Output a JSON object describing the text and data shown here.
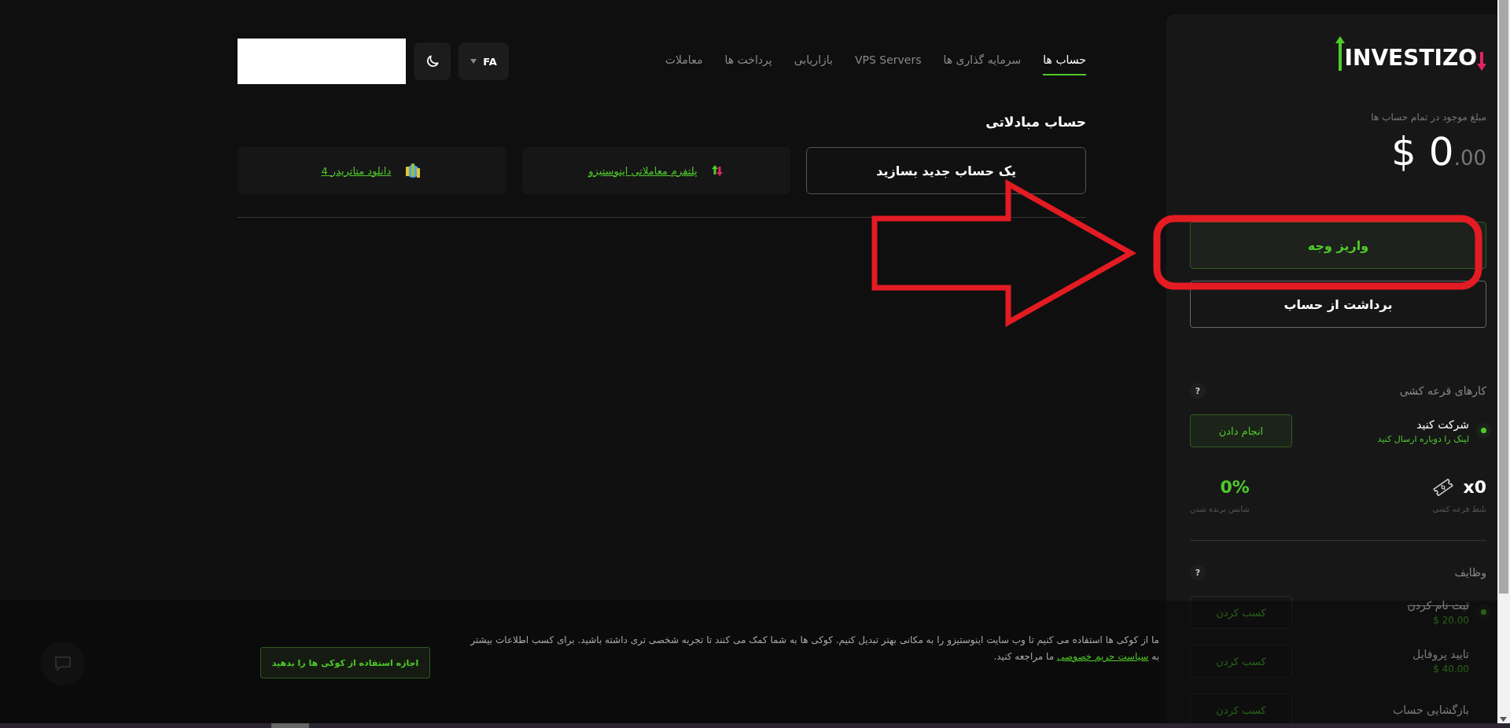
{
  "nav": {
    "tabs": [
      {
        "label": "حساب ها",
        "selected": true
      },
      {
        "label": "سرمایه گذاری ها",
        "selected": false
      },
      {
        "label": "VPS Servers",
        "selected": false
      },
      {
        "label": "بازاریابی",
        "selected": false
      },
      {
        "label": "پرداخت ها",
        "selected": false
      },
      {
        "label": "معاملات",
        "selected": false
      }
    ],
    "language": "FA"
  },
  "section": {
    "title": "حساب مبادلاتی",
    "cards": [
      {
        "kind": "create",
        "label": "یک حساب جدید بسازید"
      },
      {
        "kind": "platform",
        "label": "پلتفرم معاملاتی اینوستیزو"
      },
      {
        "kind": "metatrader",
        "label": "دانلود متاتریدر 4"
      }
    ]
  },
  "sidebar": {
    "logo": "INVESTIZO",
    "balance": {
      "label": "مبلغ موجود در تمام حساب ها",
      "amount": "$ 0",
      "decimals": ".00"
    },
    "deposit_button": "واریز وجه",
    "withdraw_button": "برداشت از حساب",
    "lottery": {
      "title": "کارهای قرعه کشی",
      "help": "?",
      "task": {
        "title": "شرکت کنید",
        "link": "لینک را دوباره ارسال کنید",
        "button": "انجام دادن",
        "active": true
      },
      "stats": [
        {
          "kind": "tickets",
          "value": "x0",
          "label": "بلیط قرعه کشی"
        },
        {
          "kind": "chance",
          "value": "0%",
          "label": "شانس برنده شدن"
        }
      ]
    },
    "tasks": {
      "title": "وظایف",
      "help": "?",
      "items": [
        {
          "title": "ثبت نام کردن",
          "amount": "$ 20.00",
          "button": "کسب کردن",
          "done": true
        },
        {
          "title": "تایید پروفایل",
          "amount": "$ 40.00",
          "button": "کسب کردن",
          "done": false
        },
        {
          "title": "بازگشایی حساب",
          "button": "کسب کردن",
          "done": false
        }
      ]
    }
  },
  "cookie": {
    "text_before": "ما از کوکی ها استفاده می کنیم تا وب سایت اینوستیزو را به مکانی بهتر تبدیل کنیم. کوکی ها به شما کمک می کنند تا تجربه شخصی تری داشته باشید. برای کسب اطلاعات بیشتر به",
    "link": "سیاست حریم خصوصی",
    "text_after": "ما مراجعه کنید.",
    "button": "اجازه استفاده از کوکی ها را بدهید"
  }
}
